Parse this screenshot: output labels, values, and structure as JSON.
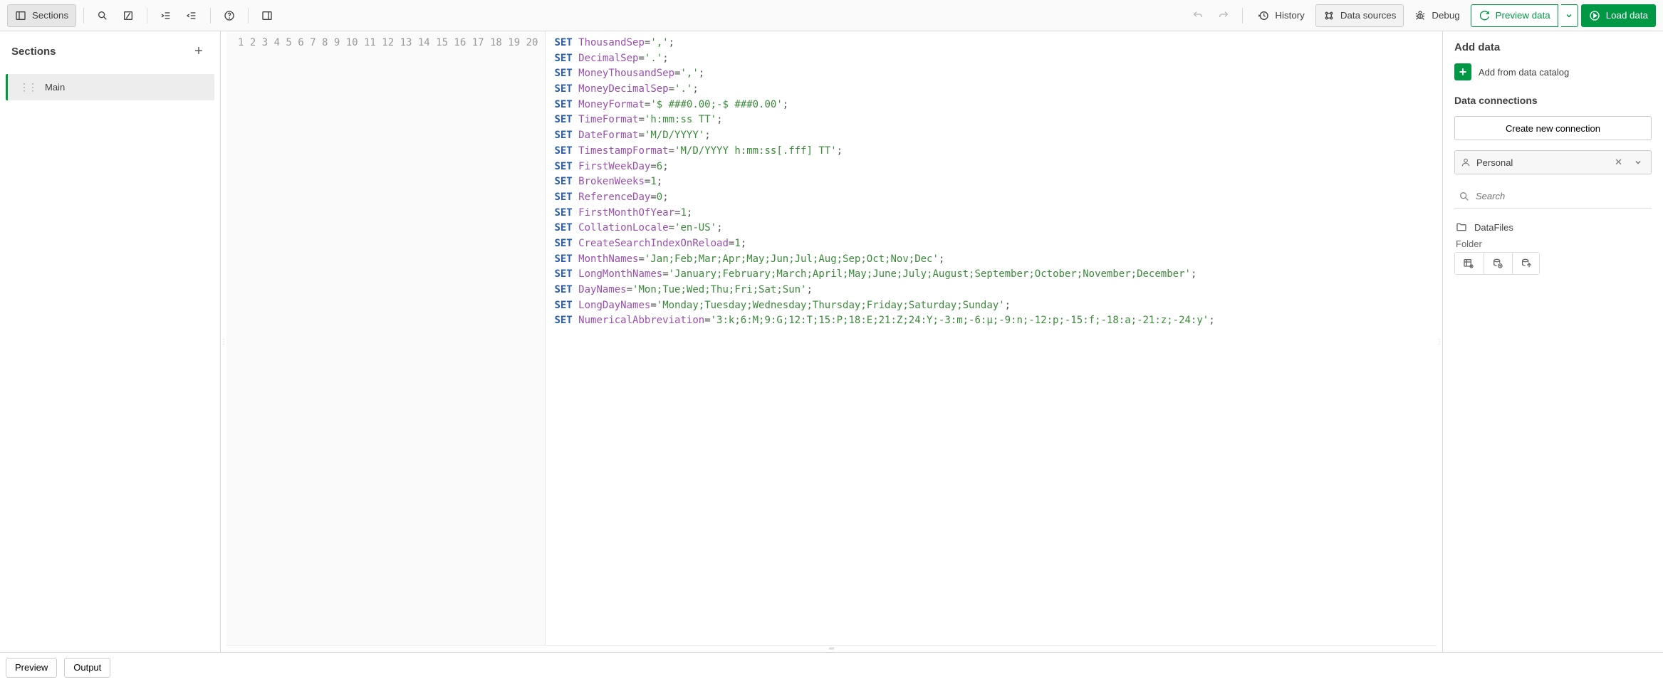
{
  "toolbar": {
    "sections_label": "Sections",
    "history_label": "History",
    "data_sources_label": "Data sources",
    "debug_label": "Debug",
    "preview_label": "Preview data",
    "load_label": "Load data"
  },
  "sections_panel": {
    "heading": "Sections",
    "items": [
      {
        "label": "Main"
      }
    ]
  },
  "editor": {
    "lines": [
      {
        "n": 1,
        "kw": "SET",
        "var": "ThousandSep",
        "eq": "=",
        "val": "','",
        "semi": ";"
      },
      {
        "n": 2,
        "kw": "SET",
        "var": "DecimalSep",
        "eq": "=",
        "val": "'.'",
        "semi": ";"
      },
      {
        "n": 3,
        "kw": "SET",
        "var": "MoneyThousandSep",
        "eq": "=",
        "val": "','",
        "semi": ";"
      },
      {
        "n": 4,
        "kw": "SET",
        "var": "MoneyDecimalSep",
        "eq": "=",
        "val": "'.'",
        "semi": ";"
      },
      {
        "n": 5,
        "kw": "SET",
        "var": "MoneyFormat",
        "eq": "=",
        "val": "'$ ###0.00;-$ ###0.00'",
        "semi": ";"
      },
      {
        "n": 6,
        "kw": "SET",
        "var": "TimeFormat",
        "eq": "=",
        "val": "'h:mm:ss TT'",
        "semi": ";"
      },
      {
        "n": 7,
        "kw": "SET",
        "var": "DateFormat",
        "eq": "=",
        "val": "'M/D/YYYY'",
        "semi": ";"
      },
      {
        "n": 8,
        "kw": "SET",
        "var": "TimestampFormat",
        "eq": "=",
        "val": "'M/D/YYYY h:mm:ss[.fff] TT'",
        "semi": ";"
      },
      {
        "n": 9,
        "kw": "SET",
        "var": "FirstWeekDay",
        "eq": "=",
        "num": "6",
        "semi": ";"
      },
      {
        "n": 10,
        "kw": "SET",
        "var": "BrokenWeeks",
        "eq": "=",
        "num": "1",
        "semi": ";"
      },
      {
        "n": 11,
        "kw": "SET",
        "var": "ReferenceDay",
        "eq": "=",
        "num": "0",
        "semi": ";"
      },
      {
        "n": 12,
        "kw": "SET",
        "var": "FirstMonthOfYear",
        "eq": "=",
        "num": "1",
        "semi": ";"
      },
      {
        "n": 13,
        "kw": "SET",
        "var": "CollationLocale",
        "eq": "=",
        "val": "'en-US'",
        "semi": ";"
      },
      {
        "n": 14,
        "kw": "SET",
        "var": "CreateSearchIndexOnReload",
        "eq": "=",
        "num": "1",
        "semi": ";"
      },
      {
        "n": 15,
        "kw": "SET",
        "var": "MonthNames",
        "eq": "=",
        "val": "'Jan;Feb;Mar;Apr;May;Jun;Jul;Aug;Sep;Oct;Nov;Dec'",
        "semi": ";"
      },
      {
        "n": 16,
        "kw": "SET",
        "var": "LongMonthNames",
        "eq": "=",
        "val": "'January;February;March;April;May;June;July;August;September;October;November;December'",
        "semi": ";"
      },
      {
        "n": 17,
        "kw": "SET",
        "var": "DayNames",
        "eq": "=",
        "val": "'Mon;Tue;Wed;Thu;Fri;Sat;Sun'",
        "semi": ";"
      },
      {
        "n": 18,
        "kw": "SET",
        "var": "LongDayNames",
        "eq": "=",
        "val": "'Monday;Tuesday;Wednesday;Thursday;Friday;Saturday;Sunday'",
        "semi": ";"
      },
      {
        "n": 19,
        "kw": "SET",
        "var": "NumericalAbbreviation",
        "eq": "=",
        "val": "'3:k;6:M;9:G;12:T;15:P;18:E;21:Z;24:Y;-3:m;-6:μ;-9:n;-12:p;-15:f;-18:a;-21:z;-24:y'",
        "semi": ";"
      },
      {
        "n": 20
      }
    ]
  },
  "data_panel": {
    "heading_add": "Add data",
    "catalog_label": "Add from data catalog",
    "heading_conn": "Data connections",
    "create_conn_label": "Create new connection",
    "space_label": "Personal",
    "search_placeholder": "Search",
    "datafiles_label": "DataFiles",
    "folder_label": "Folder"
  },
  "bottom": {
    "preview": "Preview",
    "output": "Output"
  }
}
